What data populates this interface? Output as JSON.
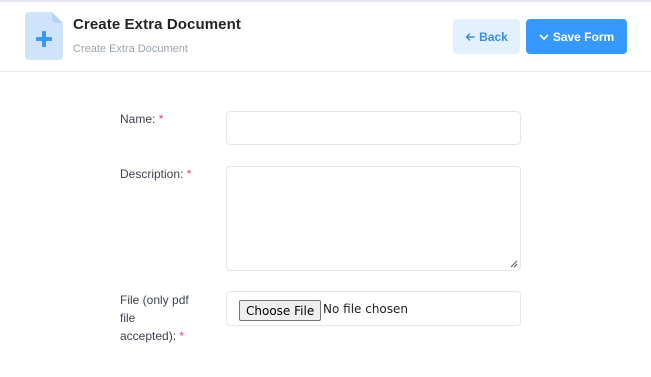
{
  "header": {
    "title": "Create Extra Document",
    "subtitle": "Create Extra Document",
    "icon": "add-document-icon",
    "back_label": "Back",
    "save_label": "Save Form"
  },
  "form": {
    "name_label": "Name:",
    "description_label": "Description:",
    "file_label_line1": "File (only pdf",
    "file_label_line2": "file",
    "file_label_line3": "accepted):",
    "required_mark": "*",
    "name_value": "",
    "description_value": "",
    "choose_file_label": "Choose File",
    "file_status": "No file chosen"
  },
  "colors": {
    "primary": "#3699ff",
    "primary_light": "#e3f0fd",
    "required": "#f1416c"
  }
}
